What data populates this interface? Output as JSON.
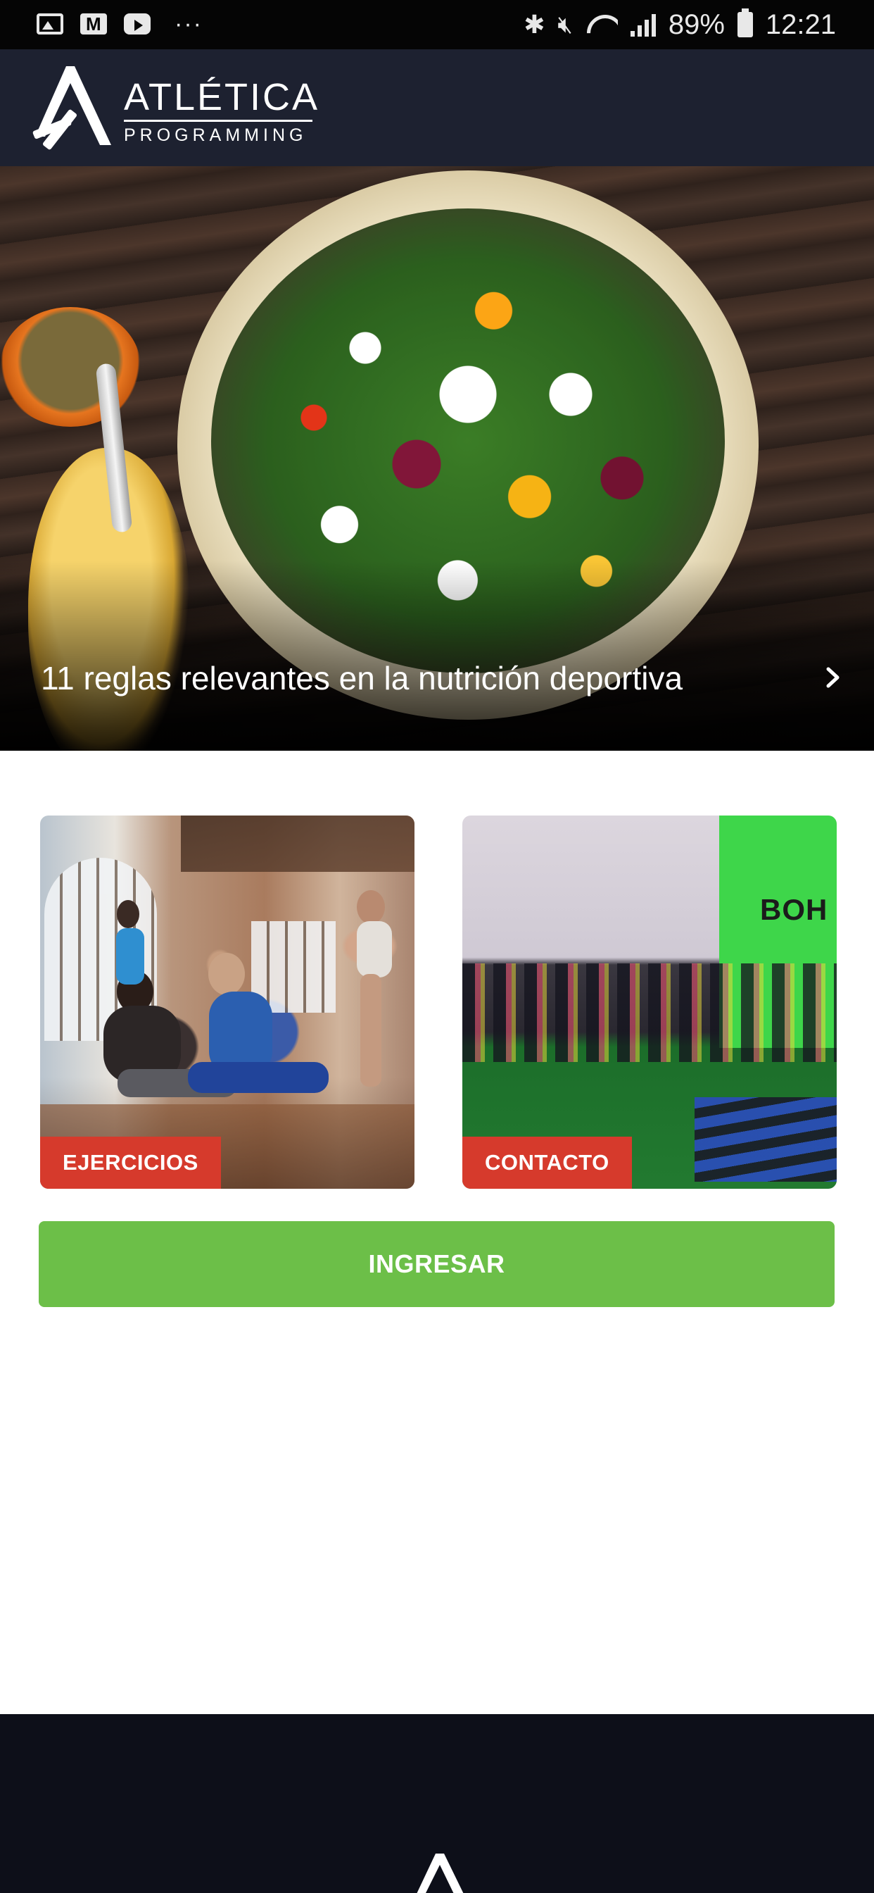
{
  "status_bar": {
    "battery_text": "89%",
    "time": "12:21",
    "overflow_dots": "···"
  },
  "header": {
    "brand_title": "ATLÉTICA",
    "brand_subtitle": "PROGRAMMING"
  },
  "hero": {
    "caption": "11 reglas relevantes en la nutrición deportiva"
  },
  "cards": {
    "exercises_label": "EJERCICIOS",
    "contact_label": "CONTACTO",
    "gym_wall_text": "BOH"
  },
  "actions": {
    "login_label": "INGRESAR"
  },
  "colors": {
    "header_bg": "#1d2130",
    "label_red": "#d63a2c",
    "button_green": "#6cbf48",
    "footer_bg": "#0d0f19"
  }
}
